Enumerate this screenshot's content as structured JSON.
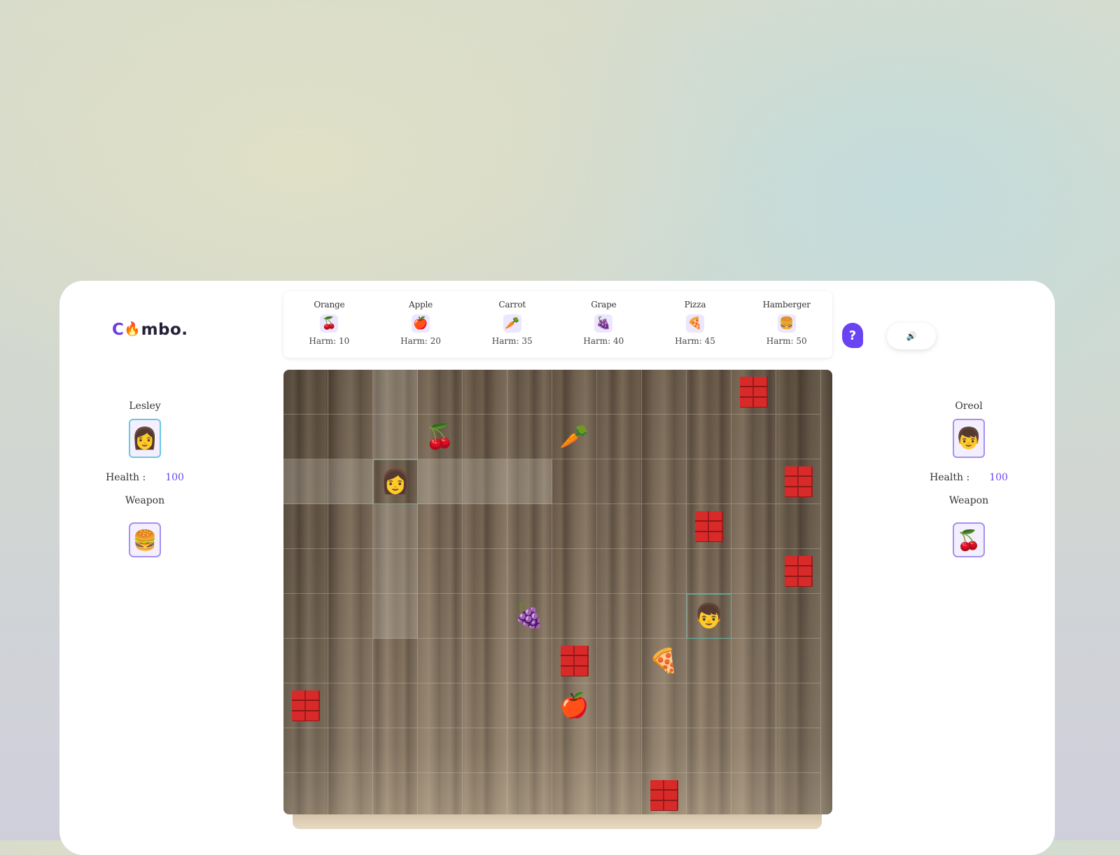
{
  "app": {
    "logo_parts": [
      "C",
      "🔥",
      "mbo."
    ]
  },
  "legend": [
    {
      "name": "Orange",
      "icon": "🍒",
      "harm": "Harm: 10"
    },
    {
      "name": "Apple",
      "icon": "🍎",
      "harm": "Harm: 20"
    },
    {
      "name": "Carrot",
      "icon": "🥕",
      "harm": "Harm: 35"
    },
    {
      "name": "Grape",
      "icon": "🍇",
      "harm": "Harm: 40"
    },
    {
      "name": "Pizza",
      "icon": "🍕",
      "harm": "Harm: 45"
    },
    {
      "name": "Hamberger",
      "icon": "🍔",
      "harm": "Harm: 50"
    }
  ],
  "controls": {
    "help_label": "?",
    "sound_icon": "🔊"
  },
  "players": {
    "left": {
      "name": "Lesley",
      "avatar": "👩",
      "health_label": "Health :",
      "health_value": "100",
      "weapon_label": "Weapon",
      "weapon_icon": "🍔"
    },
    "right": {
      "name": "Oreol",
      "avatar": "👦",
      "health_label": "Health :",
      "health_value": "100",
      "weapon_label": "Weapon",
      "weapon_icon": "🍒"
    }
  },
  "board": {
    "cols": 12,
    "rows": 10,
    "highlighted_cells": [
      [
        0,
        2
      ],
      [
        1,
        2
      ],
      [
        3,
        2
      ],
      [
        4,
        2
      ],
      [
        5,
        2
      ],
      [
        2,
        0
      ],
      [
        2,
        1
      ],
      [
        2,
        3
      ],
      [
        2,
        4
      ],
      [
        2,
        5
      ]
    ],
    "items": [
      {
        "type": "wall",
        "col": 10,
        "row": 0
      },
      {
        "type": "weapon",
        "icon": "🍒",
        "name": "orange-weapon",
        "col": 3,
        "row": 1
      },
      {
        "type": "weapon",
        "icon": "🥕",
        "name": "carrot-weapon",
        "col": 6,
        "row": 1
      },
      {
        "type": "player",
        "icon": "👩",
        "name": "player-lesley-token",
        "col": 2,
        "row": 2
      },
      {
        "type": "wall",
        "col": 11,
        "row": 2
      },
      {
        "type": "wall",
        "col": 9,
        "row": 3
      },
      {
        "type": "wall",
        "col": 11,
        "row": 4
      },
      {
        "type": "weapon",
        "icon": "🍇",
        "name": "grape-weapon",
        "col": 5,
        "row": 5
      },
      {
        "type": "player",
        "icon": "👦",
        "name": "player-oreol-token",
        "col": 9,
        "row": 5
      },
      {
        "type": "wall",
        "col": 6,
        "row": 6
      },
      {
        "type": "weapon",
        "icon": "🍕",
        "name": "pizza-weapon",
        "col": 8,
        "row": 6
      },
      {
        "type": "wall",
        "col": 0,
        "row": 7
      },
      {
        "type": "weapon",
        "icon": "🍎",
        "name": "apple-weapon",
        "col": 6,
        "row": 7
      },
      {
        "type": "wall",
        "col": 8,
        "row": 9
      }
    ]
  }
}
